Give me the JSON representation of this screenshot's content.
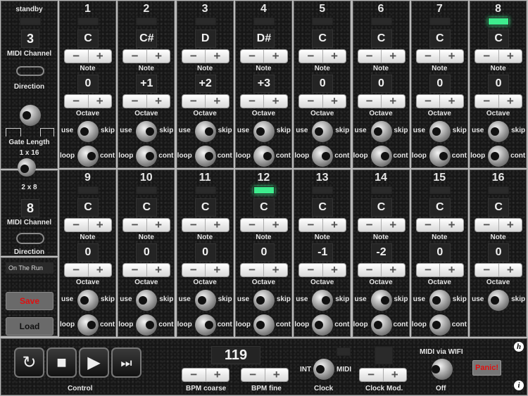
{
  "global": {
    "status": "standby",
    "midi_channel_top": "3",
    "midi_channel_label": "MIDI Channel",
    "direction_label": "Direction",
    "gate_length_label": "Gate Length",
    "mode_1x16": "1 x 16",
    "mode_2x8": "2 x 8",
    "midi_channel_bottom": "8",
    "preset_name": "On The Run",
    "save_label": "Save",
    "load_label": "Load"
  },
  "labels": {
    "note": "Note",
    "octave": "Octave",
    "use": "use",
    "skip": "skip",
    "loop": "loop",
    "cont": "cont",
    "minus": "−",
    "plus": "+"
  },
  "steps": [
    {
      "num": "1",
      "note": "C",
      "octave": "0",
      "led": false,
      "use": "left",
      "loop": "right"
    },
    {
      "num": "2",
      "note": "C#",
      "octave": "+1",
      "led": false,
      "use": "right",
      "loop": "right"
    },
    {
      "num": "3",
      "note": "D",
      "octave": "+2",
      "led": false,
      "use": "right",
      "loop": "right"
    },
    {
      "num": "4",
      "note": "D#",
      "octave": "+3",
      "led": false,
      "use": "left",
      "loop": "right"
    },
    {
      "num": "5",
      "note": "C",
      "octave": "0",
      "led": false,
      "use": "left",
      "loop": "right"
    },
    {
      "num": "6",
      "note": "C",
      "octave": "0",
      "led": false,
      "use": "left",
      "loop": "right"
    },
    {
      "num": "7",
      "note": "C",
      "octave": "0",
      "led": false,
      "use": "left",
      "loop": "right"
    },
    {
      "num": "8",
      "note": "C",
      "octave": "0",
      "led": true,
      "use": "left",
      "loop": "left"
    },
    {
      "num": "9",
      "note": "C",
      "octave": "0",
      "led": false,
      "use": "left",
      "loop": "right"
    },
    {
      "num": "10",
      "note": "C",
      "octave": "0",
      "led": false,
      "use": "left",
      "loop": "right"
    },
    {
      "num": "11",
      "note": "C",
      "octave": "0",
      "led": false,
      "use": "left",
      "loop": "right"
    },
    {
      "num": "12",
      "note": "C",
      "octave": "0",
      "led": true,
      "use": "left",
      "loop": "left"
    },
    {
      "num": "13",
      "note": "C",
      "octave": "-1",
      "led": false,
      "use": "right",
      "loop": "left"
    },
    {
      "num": "14",
      "note": "C",
      "octave": "-2",
      "led": false,
      "use": "right",
      "loop": "left"
    },
    {
      "num": "15",
      "note": "C",
      "octave": "0",
      "led": false,
      "use": "left",
      "loop": "left"
    },
    {
      "num": "16",
      "note": "C",
      "octave": "0",
      "led": false,
      "use": "left",
      "loop": null
    }
  ],
  "transport": {
    "control_label": "Control",
    "buttons": [
      "↻",
      "■",
      "▶",
      "⏭"
    ],
    "bpm": "119",
    "bpm_coarse_label": "BPM coarse",
    "bpm_fine_label": "BPM fine",
    "clock_int": "INT",
    "clock_midi": "MIDI",
    "clock_label": "Clock",
    "clock_mod_label": "Clock Mod.",
    "wifi_label": "MIDI via WIFI",
    "wifi_state": "Off",
    "panic_label": "Panic!",
    "help_icon": "h",
    "info_icon": "i"
  },
  "colors": {
    "led_on": "#3dec8d",
    "panic_text": "#e01010",
    "save_text": "#e01010"
  }
}
